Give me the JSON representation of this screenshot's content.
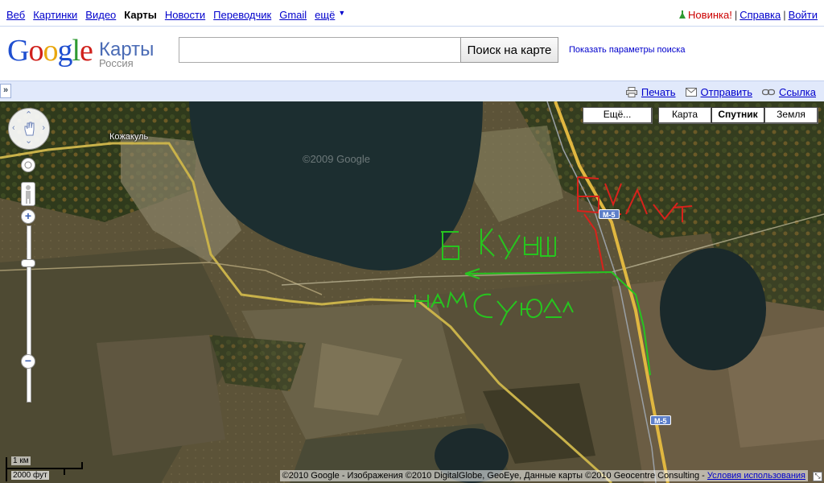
{
  "topnav": {
    "items": [
      {
        "label": "Веб",
        "active": false
      },
      {
        "label": "Картинки",
        "active": false
      },
      {
        "label": "Видео",
        "active": false
      },
      {
        "label": "Карты",
        "active": true
      },
      {
        "label": "Новости",
        "active": false
      },
      {
        "label": "Переводчик",
        "active": false
      },
      {
        "label": "Gmail",
        "active": false
      },
      {
        "label": "ещё",
        "active": false
      }
    ],
    "more_arrow": "▼",
    "new_label": "Новинка!",
    "help_label": "Справка",
    "login_label": "Войти"
  },
  "header": {
    "logo_letters": [
      "G",
      "o",
      "o",
      "g",
      "l",
      "e"
    ],
    "product": "Карты",
    "region": "Россия",
    "search_value": "",
    "search_button": "Поиск на карте",
    "search_options": "Показать параметры поиска"
  },
  "toolbar": {
    "collapse": "»",
    "print": "Печать",
    "send": "Отправить",
    "link": "Ссылка"
  },
  "map": {
    "type_buttons": {
      "more": "Ещё...",
      "map": "Карта",
      "satellite": "Спутник",
      "earth": "Земля",
      "selected": "satellite"
    },
    "town_label": "Кожакуль",
    "road_shields": [
      "М-5",
      "М-5"
    ],
    "watermark": "©2009 Google",
    "handwritten_annotations": [
      {
        "text": "Б Куяш",
        "color": "#27c41f"
      },
      {
        "text": "НАМ СЮДА",
        "color": "#27c41f"
      },
      {
        "text": "ВИАТ",
        "color": "#d8221b"
      }
    ],
    "scale": {
      "metric": "1 км",
      "imperial": "2000 фут"
    },
    "copyright": "©2010 Google - Изображения ©2010 DigitalGlobe, GeoEye, Данные карты ©2010 Geocentre Consulting -",
    "terms": "Условия использования",
    "colors": {
      "annotation_green": "#27c41f",
      "annotation_red": "#d8221b",
      "road_yellow": "#c9b24a",
      "water": "#1c2e30"
    }
  }
}
